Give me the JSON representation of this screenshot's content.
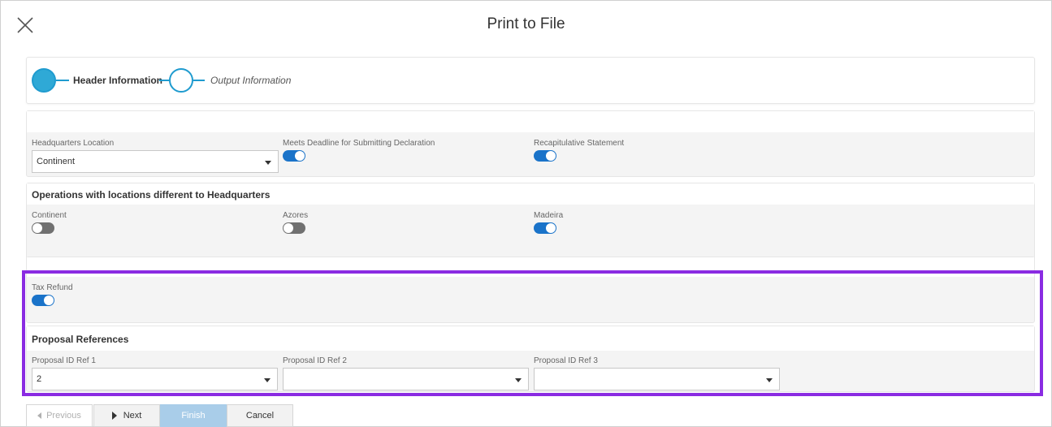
{
  "dialog": {
    "title": "Print to File"
  },
  "wizard": {
    "steps": [
      {
        "label": "Header Information",
        "state": "active"
      },
      {
        "label": "Output Information",
        "state": "inactive"
      }
    ]
  },
  "header_section": {
    "headquarters_location": {
      "label": "Headquarters Location",
      "value": "Continent"
    },
    "meets_deadline": {
      "label": "Meets Deadline for Submitting Declaration",
      "on": true
    },
    "recapitulative": {
      "label": "Recapitulative Statement",
      "on": true
    }
  },
  "operations_section": {
    "title": "Operations with locations different to Headquarters",
    "continent": {
      "label": "Continent",
      "on": false
    },
    "azores": {
      "label": "Azores",
      "on": false
    },
    "madeira": {
      "label": "Madeira",
      "on": true
    }
  },
  "refund_section": {
    "tax_refund": {
      "label": "Tax Refund",
      "on": true
    }
  },
  "proposal_section": {
    "title": "Proposal References",
    "ref1": {
      "label": "Proposal ID Ref 1",
      "value": "2"
    },
    "ref2": {
      "label": "Proposal ID Ref 2",
      "value": ""
    },
    "ref3": {
      "label": "Proposal ID Ref 3",
      "value": ""
    }
  },
  "footer": {
    "previous_label": "Previous",
    "next_label": "Next",
    "finish_label": "Finish",
    "cancel_label": "Cancel"
  },
  "colors": {
    "accent": "#1a73c9",
    "step": "#2fa9d6",
    "highlight": "#8a2be2",
    "finish_disabled": "#a9cde9"
  }
}
